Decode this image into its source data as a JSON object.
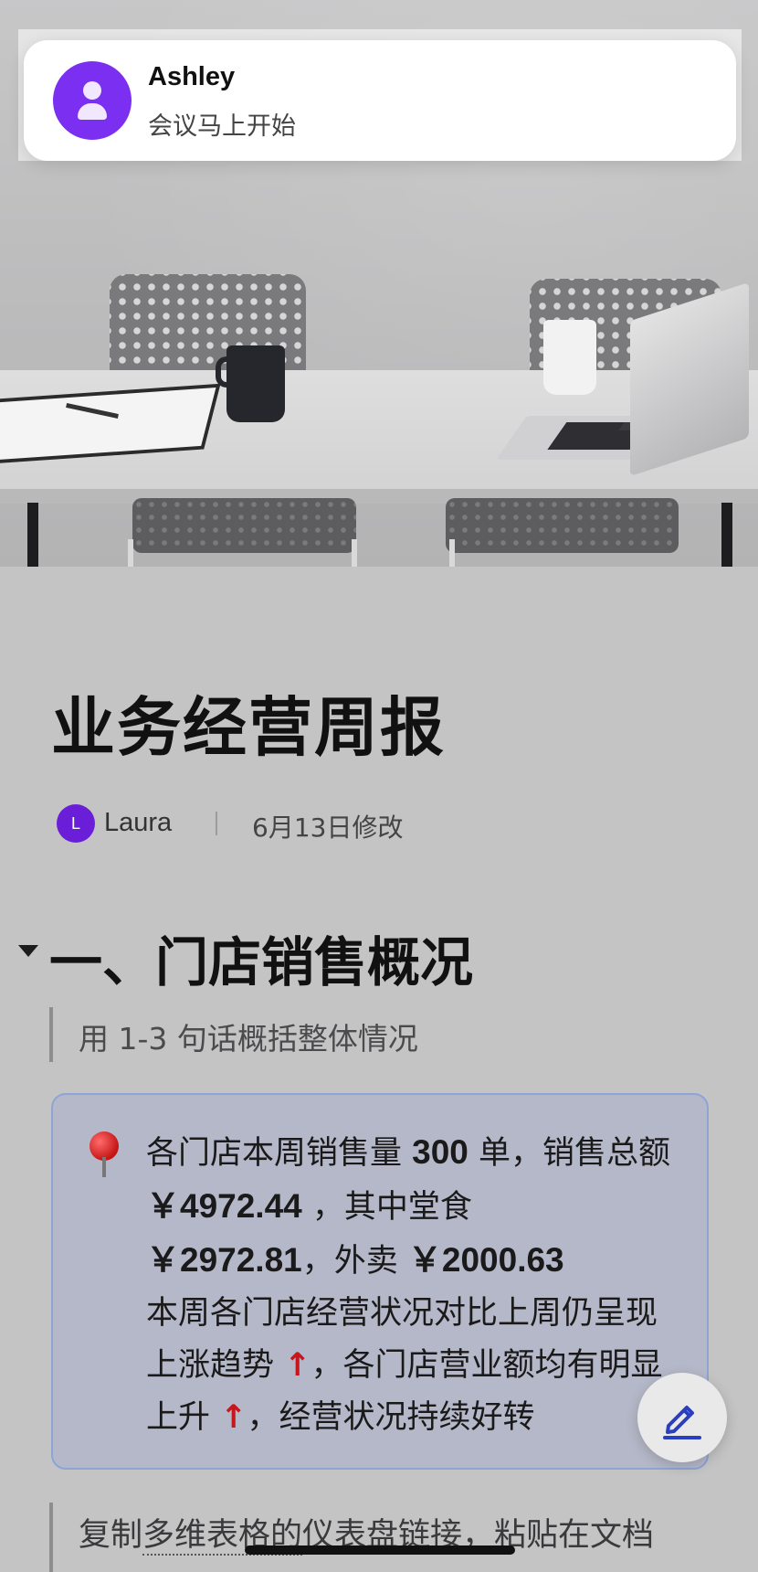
{
  "notification": {
    "sender": "Ashley",
    "message": "会议马上开始",
    "avatar_icon": "user-icon",
    "avatar_color": "#7b2ff0"
  },
  "document": {
    "title": "业务经营周报",
    "author": {
      "initial": "L",
      "name": "Laura"
    },
    "modified": "6月13日修改",
    "section1": {
      "heading": "一、门店销售概况",
      "hint": "用 1-3 句话概括整体情况",
      "callout": {
        "icon": "pushpin-icon",
        "line1_a": "各门店本周销售量 ",
        "orders": "300",
        "line1_b": " 单，销售总额 ",
        "total": "￥4972.44",
        "line1_c": " ，其中堂食 ",
        "dine_in": "￥2972.81",
        "line1_d": "，外卖 ",
        "takeout": "￥2000.63",
        "line2_a": "本周各门店经营状况对比上周仍呈现上涨趋势 ",
        "arrow1": "↑",
        "line2_b": "，各门店营业额均有明显上升 ",
        "arrow2": "↑",
        "line2_c": "，经营状况持续好转"
      }
    },
    "next_hint": {
      "pre": "复制",
      "link": "多维表格的",
      "mid": "仪表盘链接，粘贴在文档"
    }
  },
  "fab": {
    "icon": "edit-pencil-icon",
    "accent": "#2a3fbf"
  },
  "colors": {
    "arrow_up": "#c8161d",
    "callout_border": "#8ea4d6"
  }
}
